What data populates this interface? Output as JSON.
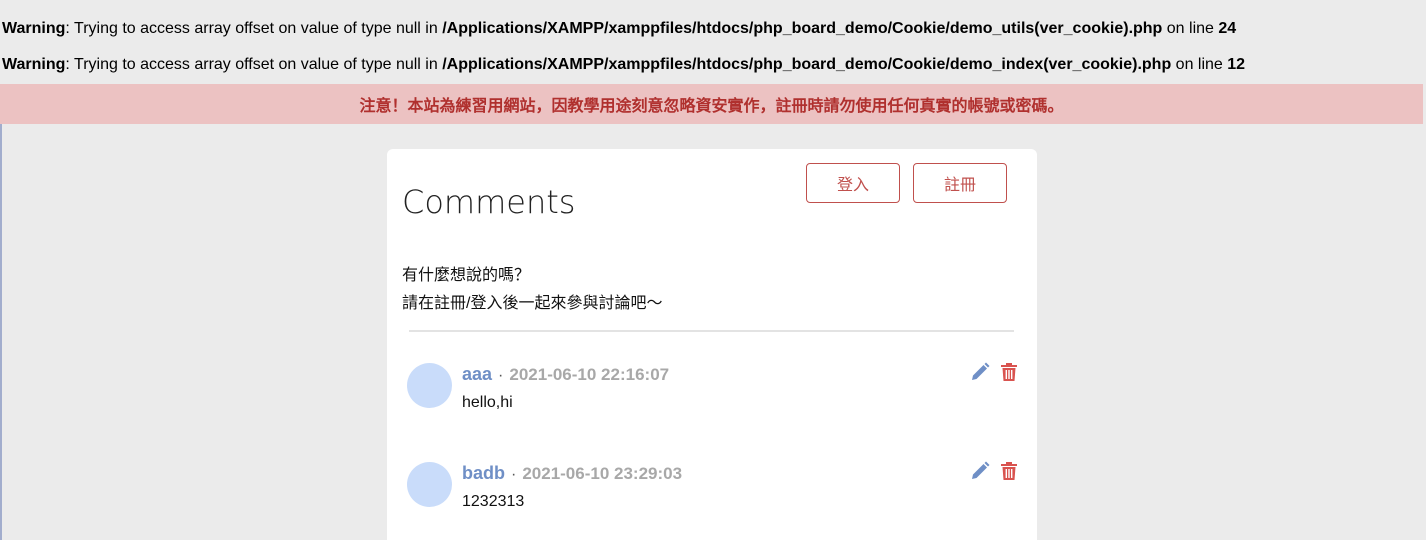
{
  "warnings": [
    {
      "label": "Warning",
      "message": ": Trying to access array offset on value of type null in ",
      "path": "/Applications/XAMPP/xamppfiles/htdocs/php_board_demo/Cookie/demo_utils(ver_cookie).php",
      "line_prefix": " on line ",
      "line": "24"
    },
    {
      "label": "Warning",
      "message": ": Trying to access array offset on value of type null in ",
      "path": "/Applications/XAMPP/xamppfiles/htdocs/php_board_demo/Cookie/demo_index(ver_cookie).php",
      "line_prefix": " on line ",
      "line": "12"
    }
  ],
  "notice": "注意！本站為練習用網站，因教學用途刻意忽略資安實作，註冊時請勿使用任何真實的帳號或密碼。",
  "board": {
    "title": "Comments",
    "login_label": "登入",
    "register_label": "註冊",
    "prompt_line1": "有什麼想說的嗎？",
    "prompt_line2": "請在註冊/登入後一起來參與討論吧～"
  },
  "comments": [
    {
      "author": "aaa",
      "separator": "·",
      "time": "2021-06-10 22:16:07",
      "content": "hello,hi"
    },
    {
      "author": "badb",
      "separator": "·",
      "time": "2021-06-10 23:29:03",
      "content": "1232313"
    }
  ],
  "colors": {
    "accent": "#c0504d",
    "notice_bg": "#ecc2c2",
    "author": "#6f8fc6",
    "edit_icon": "#6f8fc6",
    "delete_icon": "#d9534f"
  },
  "icons": [
    "pencil-icon",
    "trash-icon"
  ]
}
